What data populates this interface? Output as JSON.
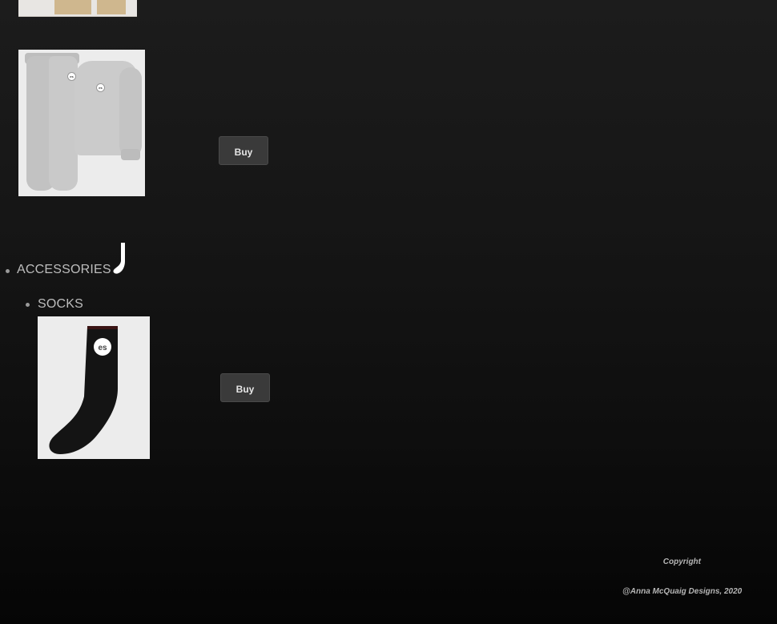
{
  "products": [
    {
      "id": "top-cropped",
      "image": "beige-pants-cropped"
    },
    {
      "id": "sweatsuit",
      "image": "grey-sweatsuit",
      "buy_label": "Buy"
    },
    {
      "id": "socks",
      "image": "black-socks",
      "buy_label": "Buy"
    }
  ],
  "categories": {
    "accessories": {
      "label": "ACCESSORIES",
      "icon": "sock-icon",
      "subcategories": [
        {
          "label": "SOCKS"
        }
      ]
    }
  },
  "brand_logo_text": "es",
  "footer": {
    "copyright": "Copyright",
    "credit": "@Anna McQuaig Designs, 2020"
  },
  "colors": {
    "background_top": "#1c1c1c",
    "background_bottom": "#050505",
    "button_bg": "#3a3a3a",
    "text": "#bdbdbd"
  }
}
